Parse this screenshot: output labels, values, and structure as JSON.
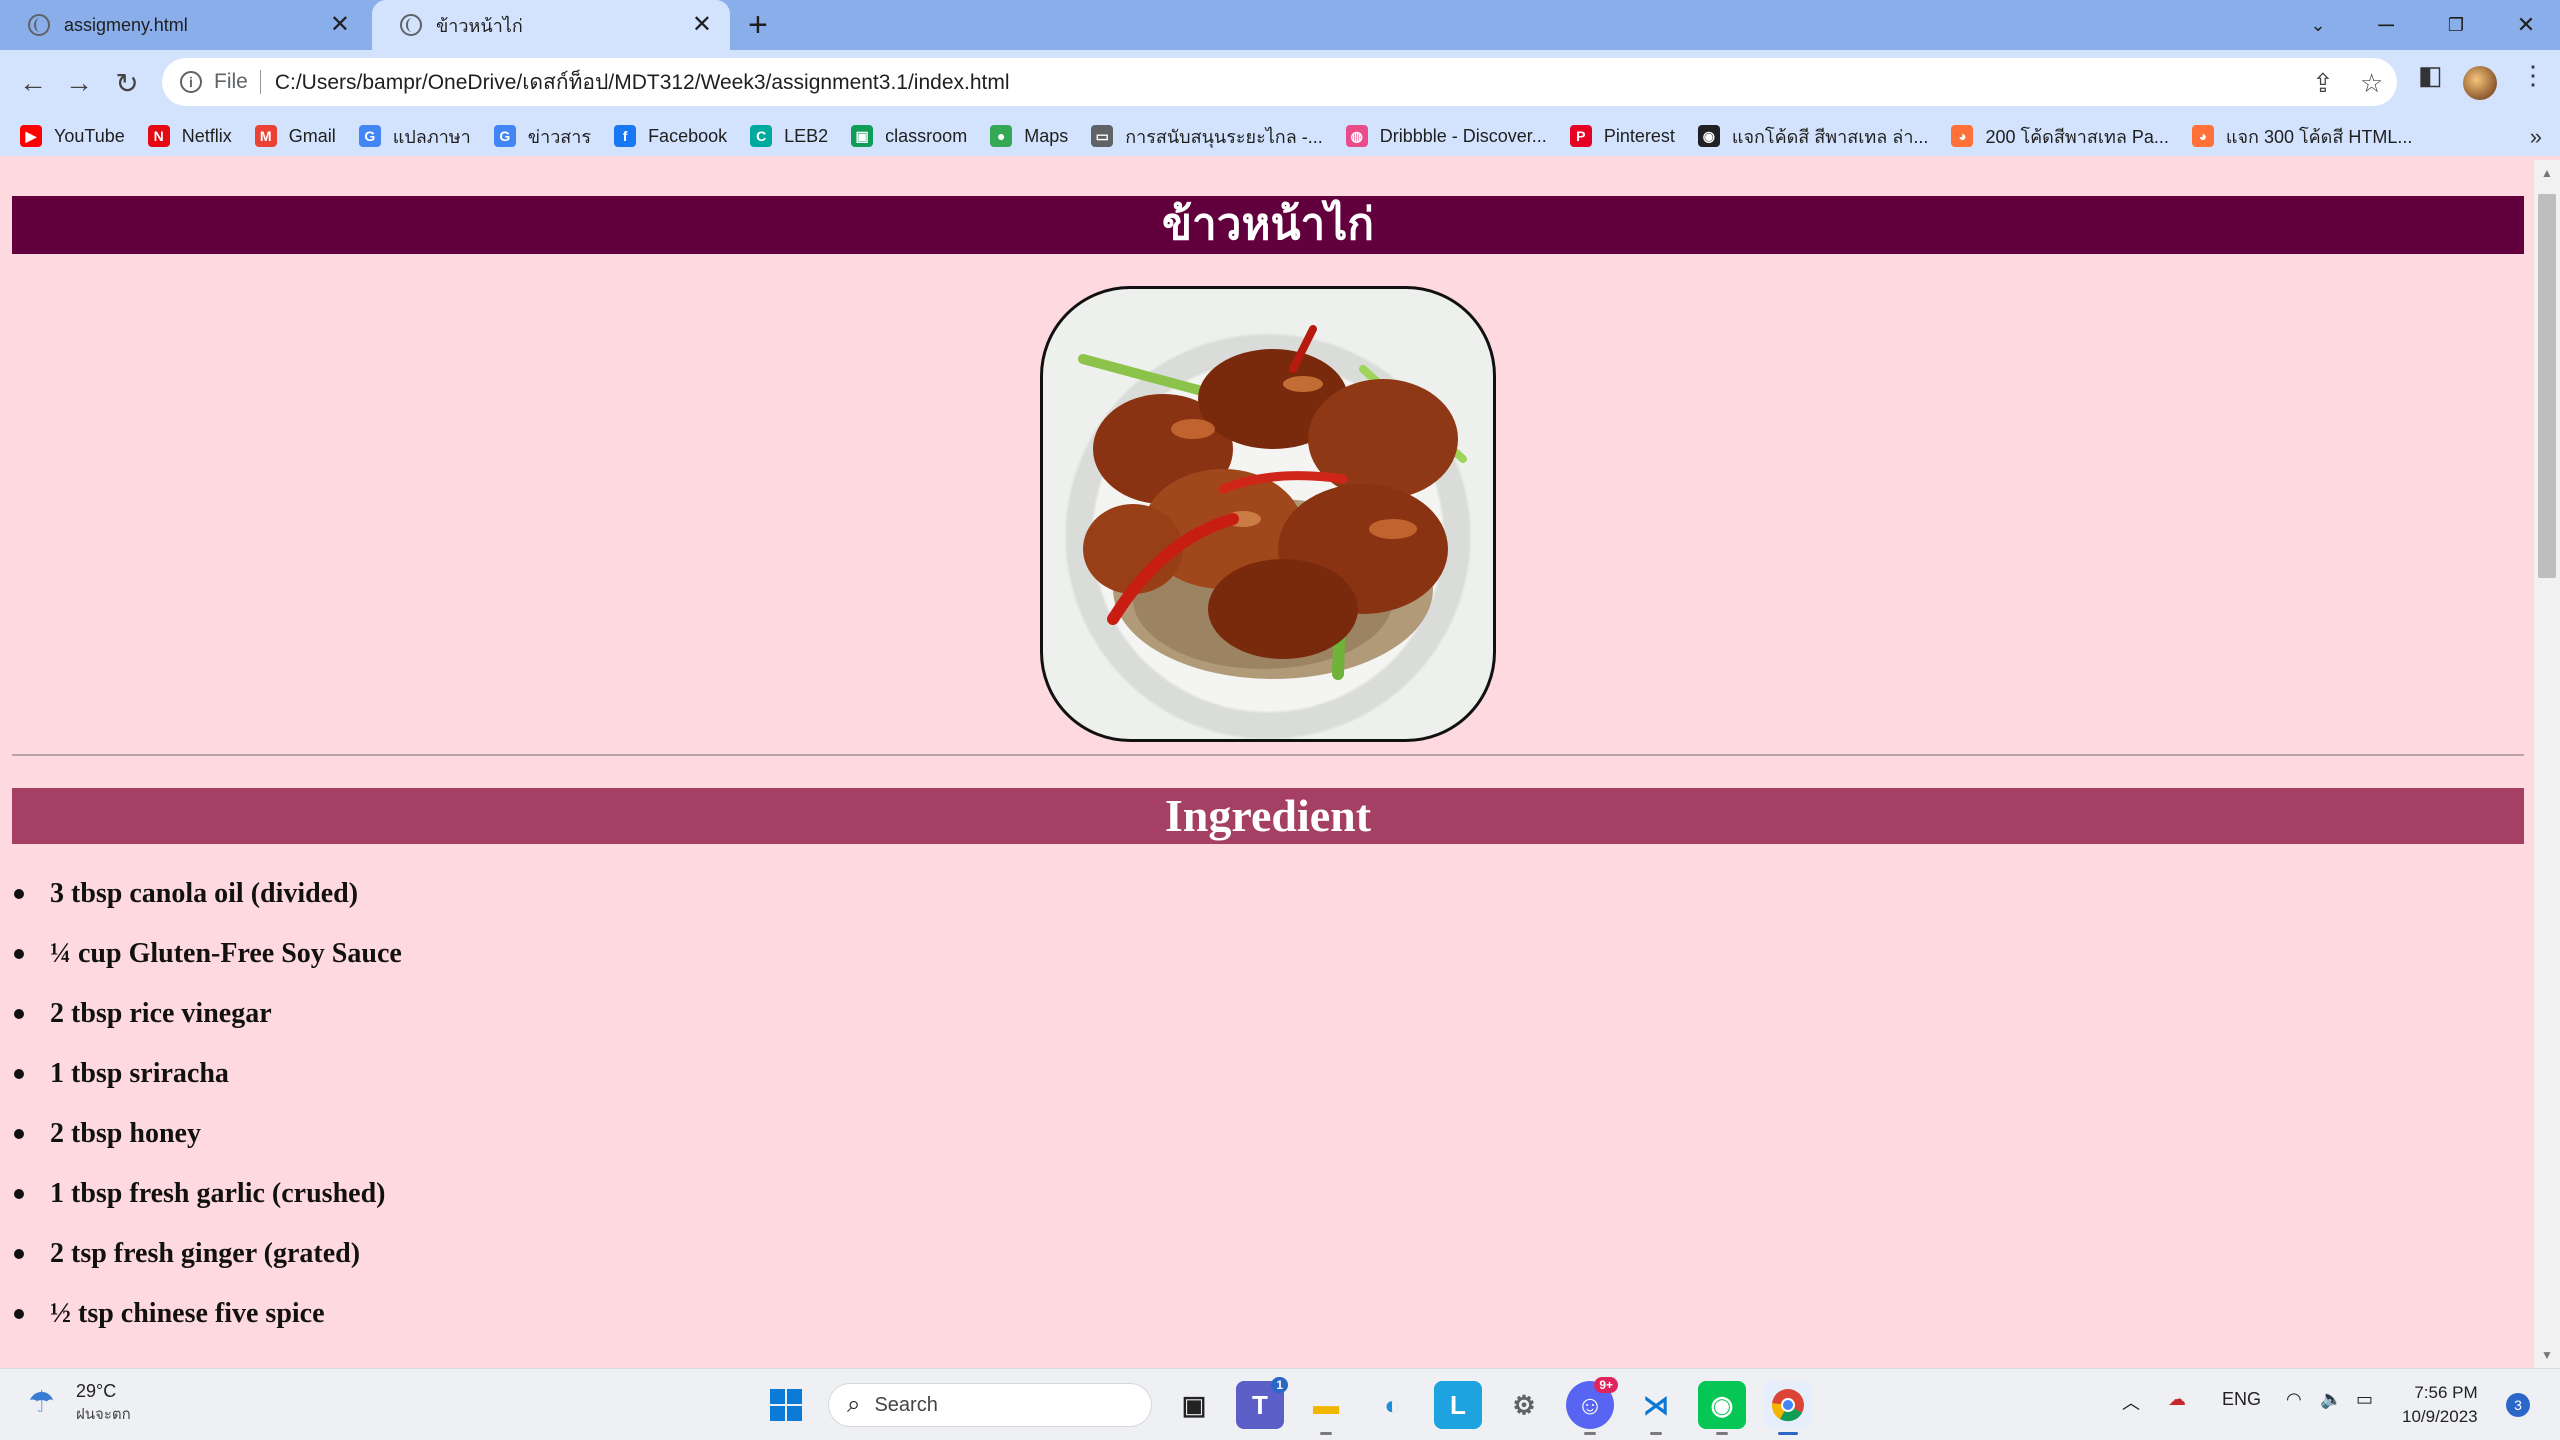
{
  "browser": {
    "tabs": [
      {
        "title": "assigmeny.html",
        "active": false
      },
      {
        "title": "ข้าวหน้าไก่",
        "active": true
      }
    ],
    "address": {
      "scheme": "File",
      "url": "C:/Users/bampr/OneDrive/เดสก์ท็อป/MDT312/Week3/assignment3.1/index.html"
    },
    "bookmarks": [
      {
        "label": "YouTube",
        "icon": "youtube-icon",
        "color": "#ff0000"
      },
      {
        "label": "Netflix",
        "icon": "netflix-icon",
        "color": "#e50914"
      },
      {
        "label": "Gmail",
        "icon": "gmail-icon",
        "color": "#ea4335"
      },
      {
        "label": "แปลภาษา",
        "icon": "translate-icon",
        "color": "#4285f4"
      },
      {
        "label": "ข่าวสาร",
        "icon": "news-icon",
        "color": "#4285f4"
      },
      {
        "label": "Facebook",
        "icon": "facebook-icon",
        "color": "#1877f2"
      },
      {
        "label": "LEB2",
        "icon": "leb2-icon",
        "color": "#00a99d"
      },
      {
        "label": "classroom",
        "icon": "classroom-icon",
        "color": "#0f9d58"
      },
      {
        "label": "Maps",
        "icon": "maps-icon",
        "color": "#34a853"
      },
      {
        "label": "การสนับสนุนระยะไกล -...",
        "icon": "remote-support-icon",
        "color": "#5f6368"
      },
      {
        "label": "Dribbble - Discover...",
        "icon": "dribbble-icon",
        "color": "#ea4c89"
      },
      {
        "label": "Pinterest",
        "icon": "pinterest-icon",
        "color": "#e60023"
      },
      {
        "label": "แจกโค้ดสี สีพาสเทล ล่า...",
        "icon": "globe-icon",
        "color": "#202124"
      },
      {
        "label": "200 โค้ดสีพาสเทล Pa...",
        "icon": "firefox-icon",
        "color": "#ff7139"
      },
      {
        "label": "แจก 300 โค้ดสี HTML...",
        "icon": "firefox-icon",
        "color": "#ff7139"
      }
    ]
  },
  "page": {
    "heading": "ข้าวหน้าไก่",
    "heading_bg": "#61003d",
    "section_title": "Ingredient",
    "section_bg": "#a53f63",
    "background": "#ffd9e0",
    "image_alt": "Glazed chicken with red chilies and green onion over rice",
    "ingredients": [
      "3 tbsp canola oil (divided)",
      "¼ cup Gluten-Free Soy Sauce",
      "2 tbsp rice vinegar",
      "1 tbsp sriracha",
      "2 tbsp honey",
      "1 tbsp fresh garlic (crushed)",
      "2 tsp fresh ginger (grated)",
      "½ tsp chinese five spice"
    ]
  },
  "taskbar": {
    "weather": {
      "temp": "29°C",
      "condition": "ฝนจะตก"
    },
    "search_placeholder": "Search",
    "tray": {
      "language": "ENG",
      "time": "7:56 PM",
      "date": "10/9/2023",
      "notifications": "3"
    },
    "badges": {
      "teams": "1",
      "discord": "9+"
    }
  }
}
